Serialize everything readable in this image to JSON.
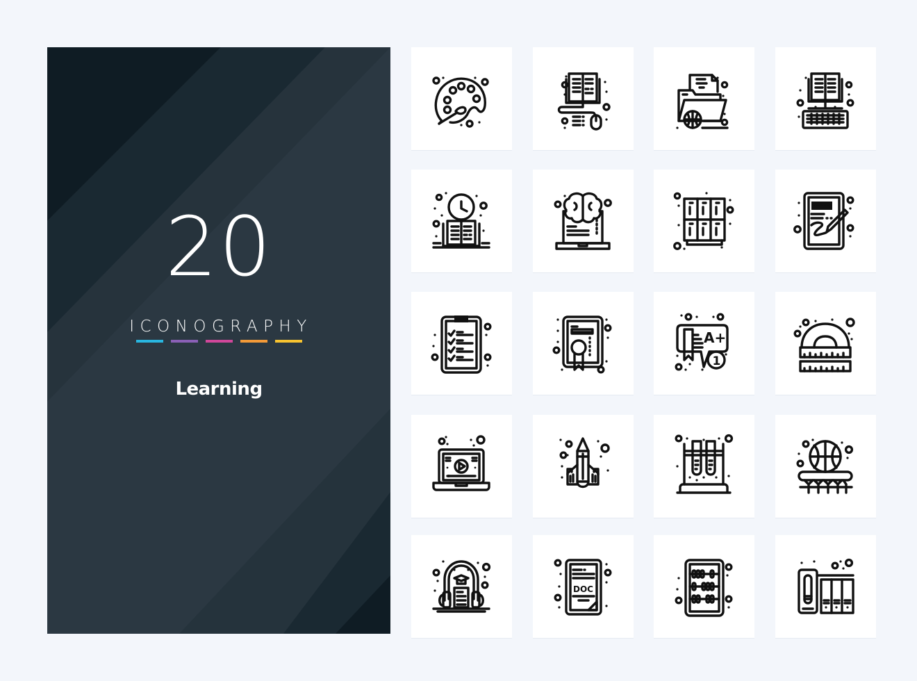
{
  "cover": {
    "count": "20",
    "brand": "ICONOGRAPHY",
    "title": "Learning",
    "accent_bars": [
      "#29b6e0",
      "#8a60b6",
      "#d0479a",
      "#f39a38",
      "#f7c330"
    ],
    "background": "#2b3842"
  },
  "icons": [
    {
      "name": "palette-icon",
      "label": "Palette"
    },
    {
      "name": "online-book-icon",
      "label": "Online book"
    },
    {
      "name": "web-folder-icon",
      "label": "Web folder"
    },
    {
      "name": "ebook-keyboard-icon",
      "label": "E-book keyboard"
    },
    {
      "name": "reading-time-icon",
      "label": "Reading time"
    },
    {
      "name": "laptop-brain-icon",
      "label": "Laptop brain"
    },
    {
      "name": "lockers-icon",
      "label": "Lockers"
    },
    {
      "name": "tablet-writing-icon",
      "label": "Tablet writing"
    },
    {
      "name": "clipboard-checklist-icon",
      "label": "Clipboard checklist"
    },
    {
      "name": "certificate-icon",
      "label": "Certificate"
    },
    {
      "name": "grade-award-icon",
      "label": "Grade award",
      "text_a": "A+",
      "text_b": "1"
    },
    {
      "name": "protractor-ruler-icon",
      "label": "Protractor ruler"
    },
    {
      "name": "video-lesson-icon",
      "label": "Video lesson"
    },
    {
      "name": "pencil-rocket-icon",
      "label": "Pencil rocket"
    },
    {
      "name": "test-tubes-icon",
      "label": "Test tubes"
    },
    {
      "name": "basketball-hoop-icon",
      "label": "Basketball hoop"
    },
    {
      "name": "audiobook-icon",
      "label": "Audiobook"
    },
    {
      "name": "doc-file-icon",
      "label": "DOC file",
      "text_a": "DOC"
    },
    {
      "name": "abacus-icon",
      "label": "Abacus"
    },
    {
      "name": "books-shelf-icon",
      "label": "Books shelf"
    }
  ]
}
